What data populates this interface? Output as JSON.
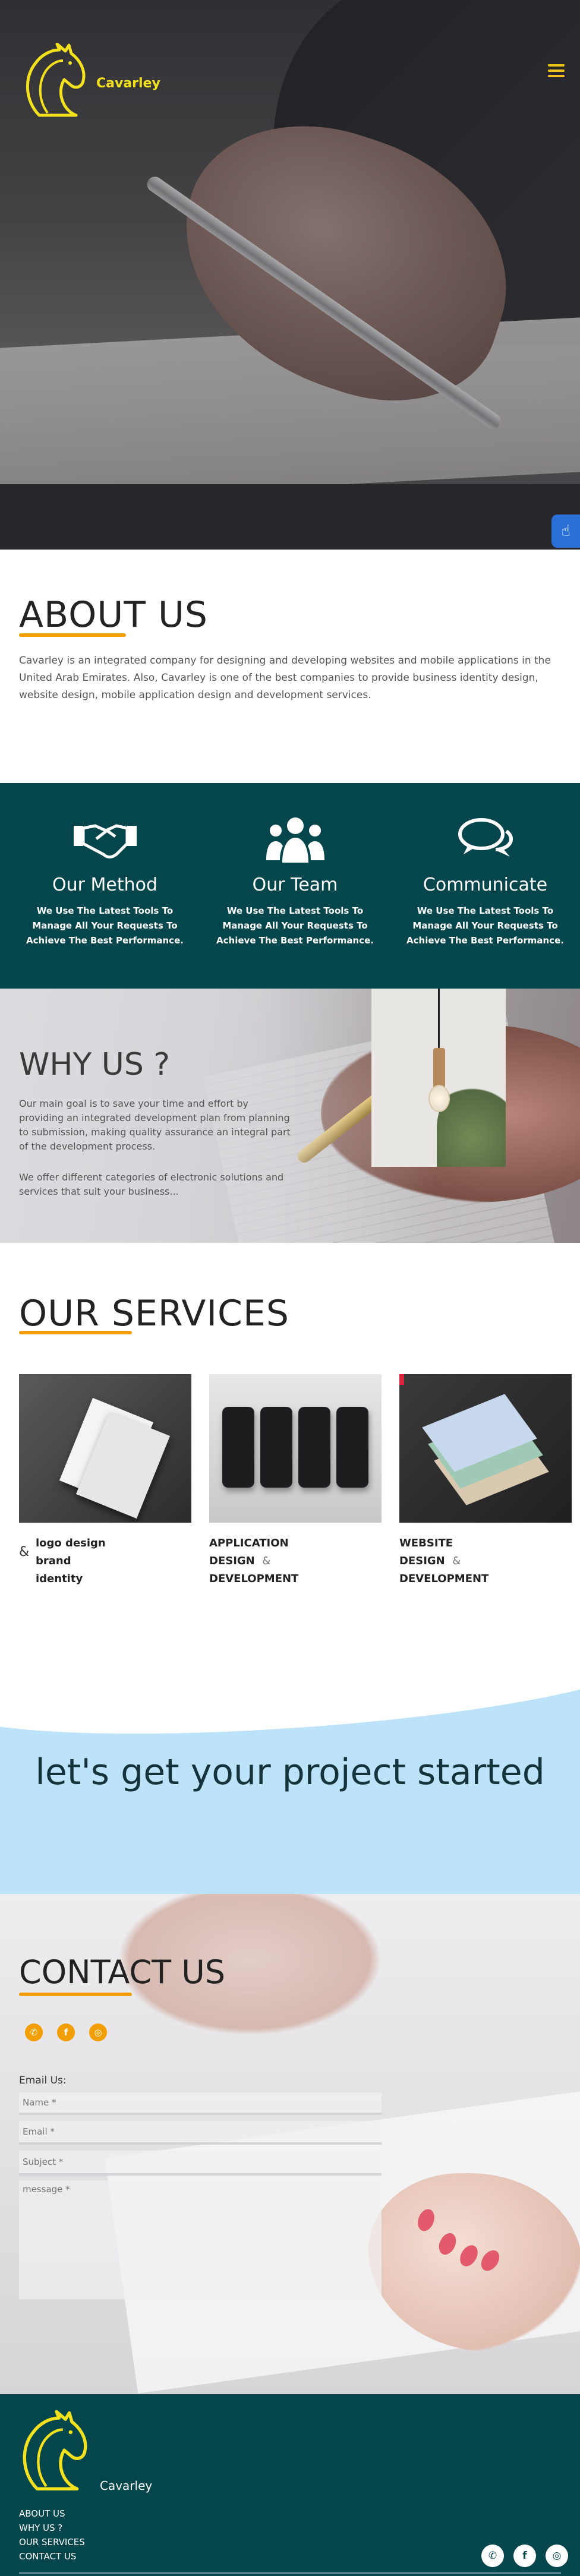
{
  "header": {
    "brand": "Cavarley",
    "menu_icon": "hamburger-menu-icon",
    "accessibility_icon": "hand-pointer-icon"
  },
  "about": {
    "title": "ABOUT US",
    "text": "Cavarley is an integrated company for designing and developing websites and mobile applications in the United Arab Emirates. Also, Cavarley is one of the best companies to provide business identity design, website design, mobile application design and development services."
  },
  "features": [
    {
      "icon": "handshake-icon",
      "title": "Our Method",
      "desc": "We Use The Latest Tools To Manage All Your Requests To Achieve The Best Performance."
    },
    {
      "icon": "users-group-icon",
      "title": "Our Team",
      "desc": "We Use The Latest Tools To Manage All Your Requests To Achieve The Best Performance."
    },
    {
      "icon": "chat-bubbles-icon",
      "title": "Communicate",
      "desc": "We Use The Latest Tools To Manage All Your Requests To Achieve The Best Performance."
    }
  ],
  "why": {
    "title": "WHY US ?",
    "p1": "Our main goal is to save your time and effort by providing an integrated development plan from planning to submission, making quality assurance an integral part of the development process.",
    "p2": "We offer different categories of electronic solutions and services that suit your business..."
  },
  "services": {
    "title": "OUR SERVICES",
    "amp": "&",
    "items": [
      {
        "line1": "logo design",
        "line2": "brand",
        "line3": "identity"
      },
      {
        "line1": "APPLICATION",
        "line2": "DESIGN",
        "amp": "&",
        "line3": "DEVELOPMENT"
      },
      {
        "line1": "WEBSITE",
        "line2": "DESIGN",
        "amp": "&",
        "line3": "DEVELOPMENT"
      }
    ]
  },
  "cta": {
    "text": "let's get your project started"
  },
  "contact": {
    "title": "CONTACT US",
    "social": [
      "whatsapp-icon",
      "facebook-icon",
      "instagram-icon"
    ],
    "email_label": "Email Us:",
    "name_placeholder": "Name *",
    "email_placeholder": "Email *",
    "subject_placeholder": "Subject *",
    "message_placeholder": "message *"
  },
  "footer": {
    "brand": "Cavarley",
    "links": [
      "ABOUT US",
      "WHY US ?",
      "OUR SERVICES",
      "CONTACT US"
    ],
    "social": [
      "whatsapp-icon",
      "facebook-icon",
      "instagram-icon"
    ]
  },
  "colors": {
    "accent_orange": "#f29f05",
    "brand_yellow": "#f3e11d",
    "teal": "#04464b",
    "cta_blue": "#bde3fb"
  }
}
